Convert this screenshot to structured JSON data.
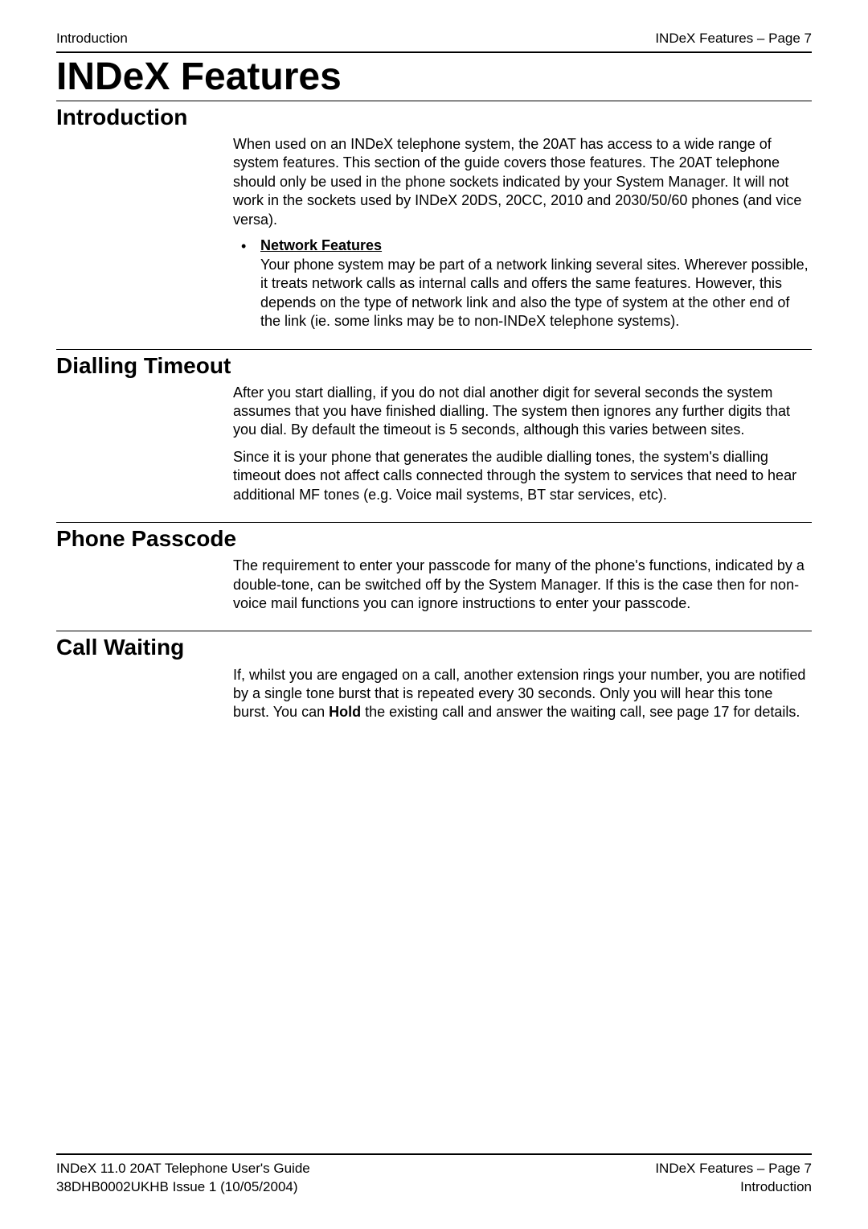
{
  "header": {
    "left": "Introduction",
    "right": "INDeX Features – Page 7"
  },
  "page_title": "INDeX Features",
  "sections": {
    "introduction": {
      "heading": "Introduction",
      "para1": "When used on an INDeX telephone system, the 20AT has access to a wide range of system features. This section of the guide covers those features. The 20AT telephone should only be used in the phone sockets indicated by your System Manager. It will not work in the sockets used by INDeX 20DS, 20CC, 2010 and 2030/50/60 phones (and vice versa).",
      "bullet": {
        "title": "Network Features",
        "text": "Your phone system may be part of a network linking several sites. Wherever possible, it treats network calls as internal calls and offers the same features. However, this depends on the type of network link and also the type of system at the other end of the link (ie. some links may be to non-INDeX telephone systems)."
      }
    },
    "dialling": {
      "heading": "Dialling Timeout",
      "para1": "After you start dialling, if you do not dial another digit for several seconds the system assumes that you have finished dialling. The system then ignores any further digits that you dial. By default the timeout is 5 seconds, although this varies between sites.",
      "para2": "Since it is your phone that generates the audible dialling tones, the system's dialling timeout does not affect calls connected through the system to services that need to hear additional MF tones (e.g. Voice mail systems, BT star services, etc)."
    },
    "passcode": {
      "heading": "Phone Passcode",
      "para1": "The requirement to enter your passcode for many of the phone's functions, indicated by a double-tone, can be switched off by the System Manager. If this is the case then for non-voice mail functions you can ignore instructions to enter your passcode."
    },
    "callwaiting": {
      "heading": "Call Waiting",
      "para_pre": "If, whilst you are engaged on a call, another extension rings your number, you are notified by a single tone burst that is repeated every 30 seconds. Only you will hear this tone burst. You can ",
      "para_bold": "Hold",
      "para_post": " the existing call and answer the waiting call, see page 17 for details."
    }
  },
  "footer": {
    "left1": "INDeX 11.0 20AT Telephone User's Guide",
    "left2": "38DHB0002UKHB Issue 1 (10/05/2004)",
    "right1": "INDeX Features – Page 7",
    "right2": "Introduction"
  }
}
